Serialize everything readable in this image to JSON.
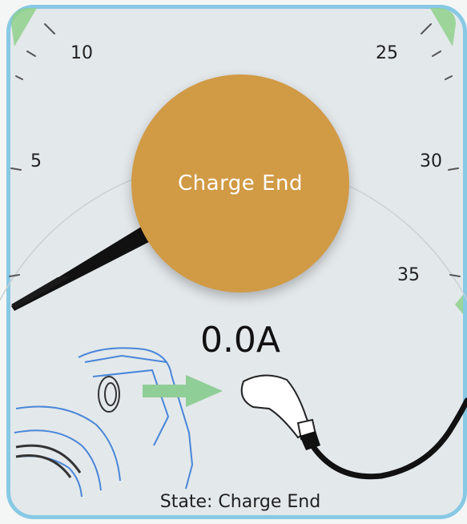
{
  "gauge": {
    "ticks": [
      "10",
      "25",
      "5",
      "30",
      "35"
    ],
    "accent_zone_color": "#8fd08c",
    "needle_color": "#111111"
  },
  "charge_button": {
    "label": "Charge End",
    "color": "#d19a45"
  },
  "readout": {
    "current": "0.0A"
  },
  "status": {
    "state_text": "State: Charge End"
  },
  "illustration": {
    "car_icon": "car-outline-icon",
    "arrow_icon": "plug-in-arrow-icon",
    "plug_icon": "ev-charging-plug-icon"
  },
  "colors": {
    "frame_border": "#88c9e4",
    "panel_background": "#e3e8eb",
    "car_outline": "#4a86d8",
    "arrow": "#8fce96"
  }
}
